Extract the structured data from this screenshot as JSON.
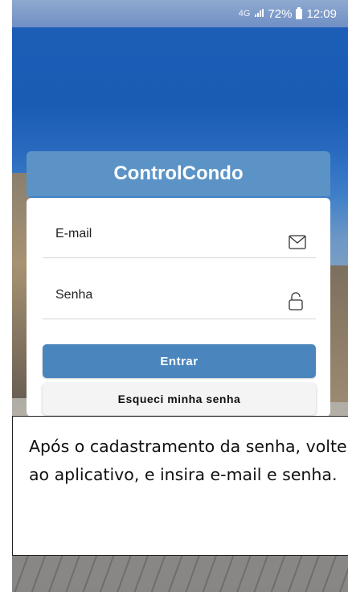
{
  "status_bar": {
    "network": "4G",
    "battery": "72%",
    "time": "12:09"
  },
  "app": {
    "title": "ControlCondo"
  },
  "login": {
    "email_label": "E-mail",
    "password_label": "Senha",
    "submit_label": "Entrar",
    "forgot_label": "Esqueci minha senha"
  },
  "instruction": {
    "text": "Após o cadastramento da senha, volte ao aplicativo, e insira e-mail e senha."
  },
  "colors": {
    "header": "#5b93c6",
    "primary_button": "#4a86bd"
  }
}
